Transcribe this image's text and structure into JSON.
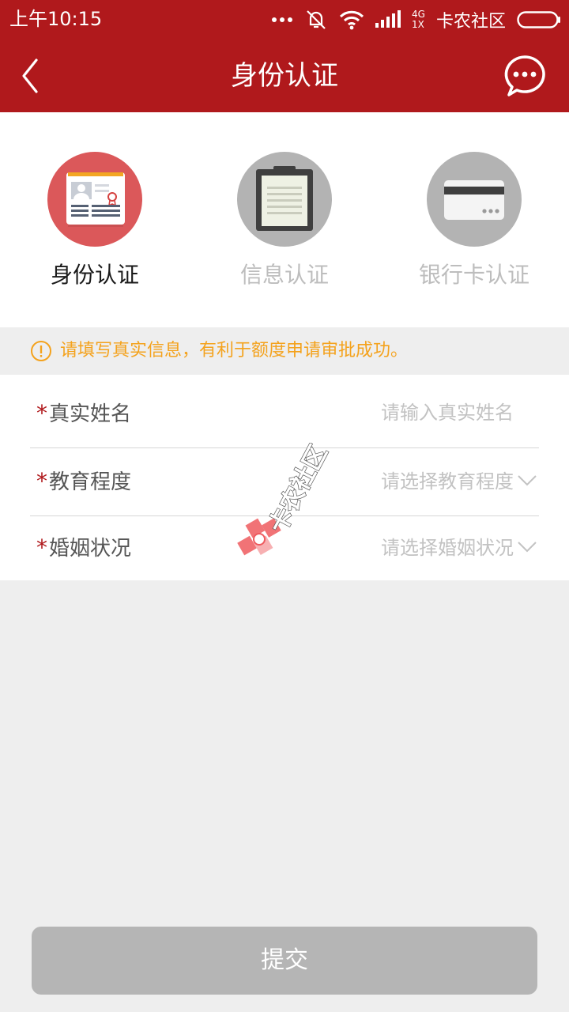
{
  "status_bar": {
    "time": "上午10:15",
    "network_small": "4G",
    "network_small2": "1X",
    "carrier": "卡农社区"
  },
  "nav": {
    "title": "身份认证"
  },
  "steps": [
    {
      "label": "身份认证",
      "active": true
    },
    {
      "label": "信息认证",
      "active": false
    },
    {
      "label": "银行卡认证",
      "active": false
    }
  ],
  "notice": {
    "text": "请填写真实信息，有利于额度申请审批成功。"
  },
  "form": {
    "name": {
      "label": "真实姓名",
      "placeholder": "请输入真实姓名",
      "value": ""
    },
    "education": {
      "label": "教育程度",
      "value": "请选择教育程度"
    },
    "marital": {
      "label": "婚姻状况",
      "value": "请选择婚姻状况"
    },
    "required_mark": "*"
  },
  "submit": {
    "label": "提交"
  },
  "watermark": {
    "text": "卡农社区"
  },
  "colors": {
    "brand": "#b0191c",
    "notice": "#f4a21c",
    "disabled_button": "#b5b5b5"
  }
}
